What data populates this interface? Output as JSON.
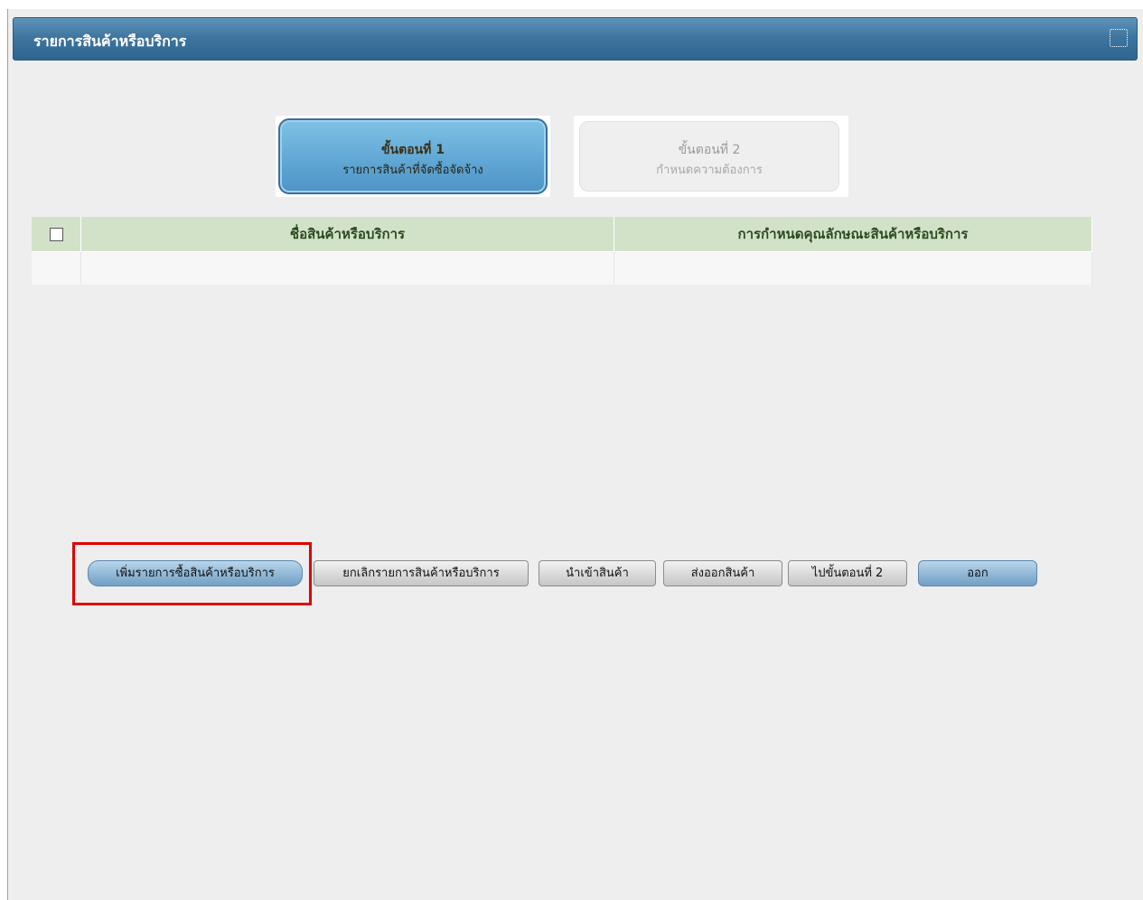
{
  "window": {
    "title": "รายการสินค้าหรือบริการ",
    "max_icon": "maximize-icon"
  },
  "steps": [
    {
      "number": "ขั้นตอนที่ 1",
      "label": "รายการสินค้าที่จัดซื้อจัดจ้าง",
      "active": true
    },
    {
      "number": "ขั้นตอนที่ 2",
      "label": "กำหนดความต้องการ",
      "active": false
    }
  ],
  "table": {
    "columns": [
      "",
      "ชื่อสินค้าหรือบริการ",
      "การกำหนดคุณลักษณะสินค้าหรือบริการ"
    ],
    "rows": []
  },
  "buttons": {
    "add": "เพิ่มรายการซื้อสินค้าหรือบริการ",
    "cancel": "ยกเลิกรายการสินค้าหรือบริการ",
    "import": "นำเข้าสินค้า",
    "export": "ส่งออกสินค้า",
    "next": "ไปขั้นตอนที่ 2",
    "exit": "ออก"
  },
  "colors": {
    "titlebar": "#3f76a0",
    "header_green": "#d2e2c9",
    "highlight": "#e00000"
  }
}
